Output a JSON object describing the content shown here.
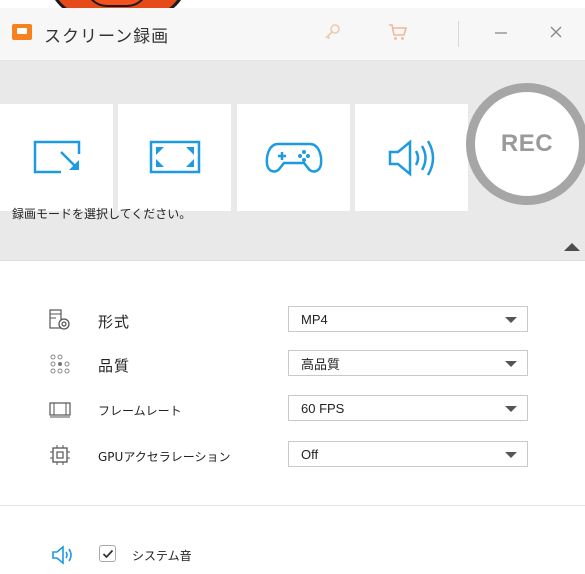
{
  "window": {
    "title": "スクリーン録画",
    "icons": [
      "app-icon",
      "key-icon",
      "cart-icon",
      "minimize-icon",
      "close-icon"
    ]
  },
  "modes": {
    "buttons": [
      {
        "name": "region-capture",
        "icon": "region-capture-icon"
      },
      {
        "name": "fullscreen-capture",
        "icon": "fullscreen-icon"
      },
      {
        "name": "game-capture",
        "icon": "gamepad-icon"
      },
      {
        "name": "audio-capture",
        "icon": "speaker-icon"
      }
    ],
    "rec_label": "REC",
    "hint": "録画モードを選択してください。"
  },
  "settings": {
    "format": {
      "label": "形式",
      "value": "MP4"
    },
    "quality": {
      "label": "品質",
      "value": "高品質"
    },
    "framerate": {
      "label": "フレームレート",
      "value": "60 FPS"
    },
    "gpu": {
      "label": "GPUアクセラレーション",
      "value": "Off"
    }
  },
  "audio": {
    "system_sound_label": "システム音",
    "system_sound_checked": true
  },
  "colors": {
    "accent_blue": "#1e9be0",
    "titlebar": "#f7f7f7",
    "mode_bg": "#e9e9e9",
    "rec_gray": "#a6a6a6",
    "app_orange": "#f5821f"
  }
}
